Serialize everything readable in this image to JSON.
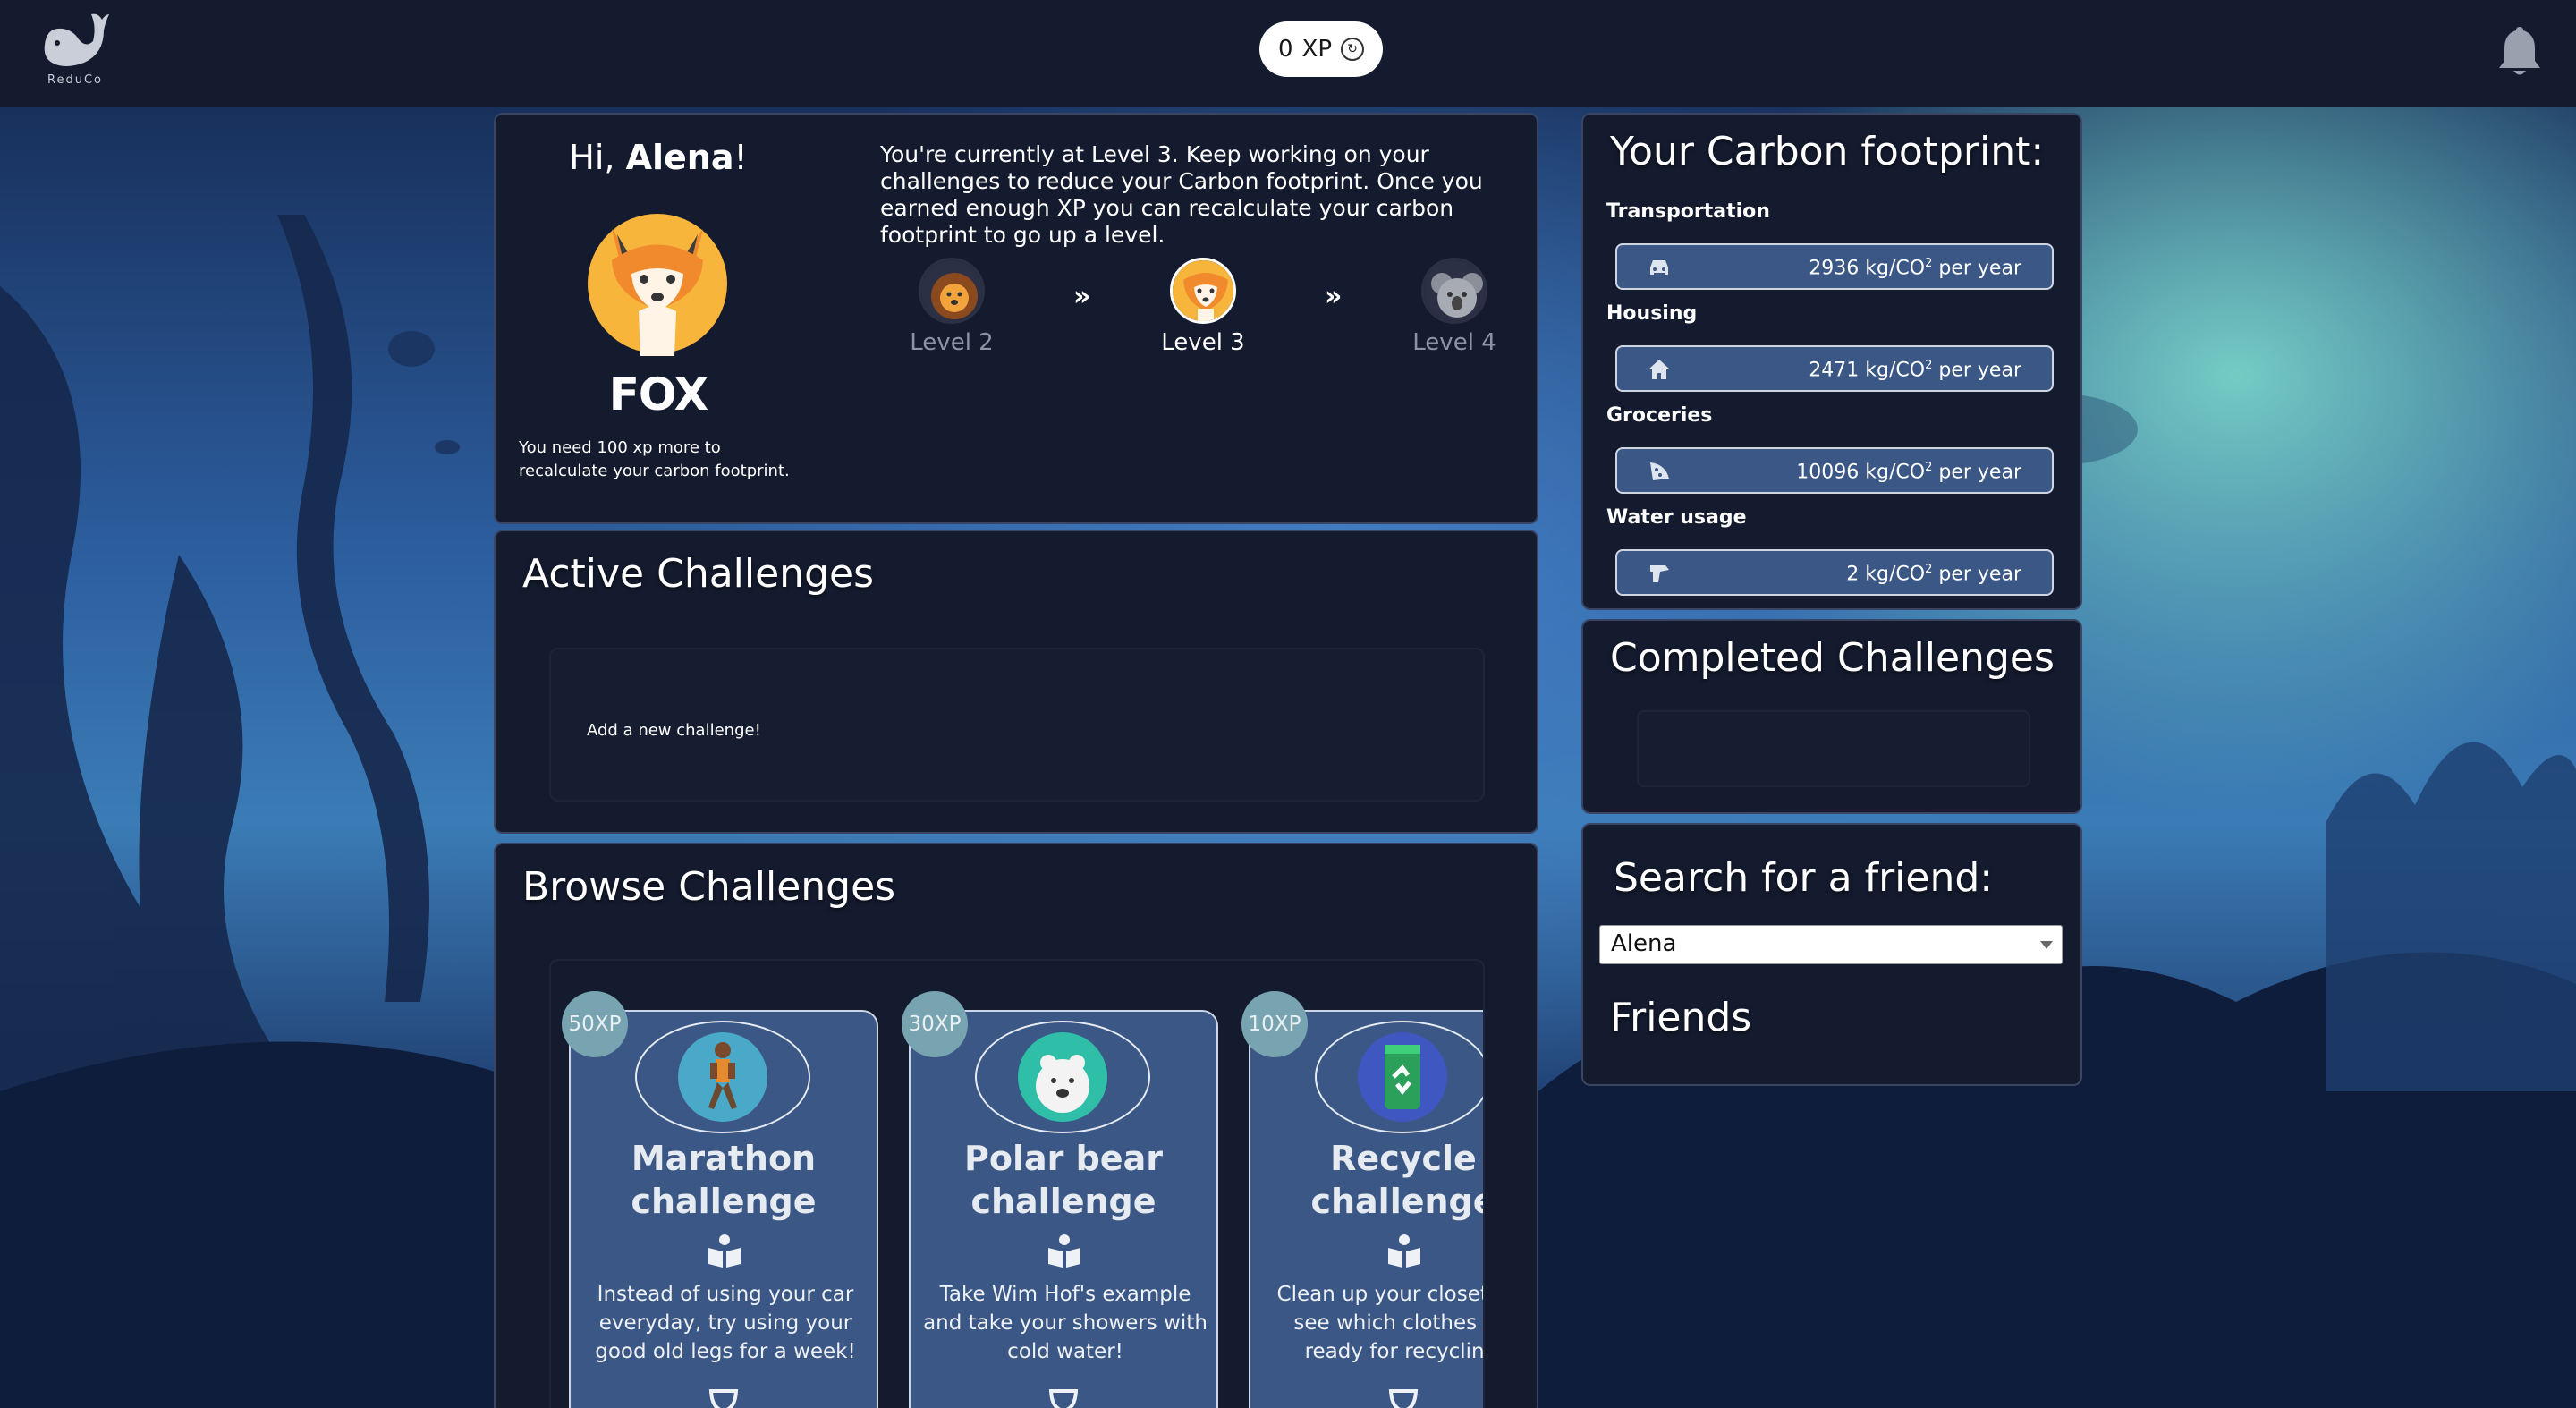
{
  "app": {
    "logo_text": "ReduCo"
  },
  "header": {
    "xp_value": "0",
    "xp_label": "XP"
  },
  "profile": {
    "greeting_prefix": "Hi, ",
    "user_name": "Alena",
    "greeting_suffix": "!",
    "animal_name": "FOX",
    "need_xp_text": "You need 100 xp more to recalculate your carbon footprint.",
    "level_text": "You're currently at Level 3. Keep working on your challenges to reduce your Carbon footprint. Once you earned enough XP you can recalculate your carbon footprint to go up a level.",
    "levels": [
      {
        "label": "Level 2",
        "animal": "lion"
      },
      {
        "label": "Level 3",
        "animal": "fox"
      },
      {
        "label": "Level 4",
        "animal": "koala"
      }
    ],
    "arrow": "»"
  },
  "active_challenges": {
    "title": "Active Challenges",
    "add_new_text": "Add a new challenge!"
  },
  "browse_challenges": {
    "title": "Browse Challenges",
    "cards": [
      {
        "xp": "50XP",
        "name": "Marathon challenge",
        "description": "Instead of using your car everyday, try using your good old legs for a week!",
        "icon": "runner-icon"
      },
      {
        "xp": "30XP",
        "name": "Polar bear challenge",
        "description": "Take Wim Hof's example and take your showers with cold water!",
        "icon": "polar-bear-icon"
      },
      {
        "xp": "10XP",
        "name": "Recycle challenge",
        "description": "Clean up your closet and see which clothes are ready for recycling!",
        "icon": "recycle-icon"
      }
    ]
  },
  "carbon": {
    "title": "Your Carbon footprint:",
    "unit_prefix": "kg/CO",
    "unit_sup": "2",
    "unit_suffix": " per year",
    "items": [
      {
        "label": "Transportation",
        "value": "2936",
        "icon": "car-icon"
      },
      {
        "label": "Housing",
        "value": "2471",
        "icon": "house-icon"
      },
      {
        "label": "Groceries",
        "value": "10096",
        "icon": "pizza-icon"
      },
      {
        "label": "Water usage",
        "value": "2",
        "icon": "faucet-icon"
      }
    ]
  },
  "completed_challenges": {
    "title": "Completed Challenges"
  },
  "friends": {
    "search_title": "Search for a friend:",
    "search_value": "Alena",
    "friends_title": "Friends"
  }
}
